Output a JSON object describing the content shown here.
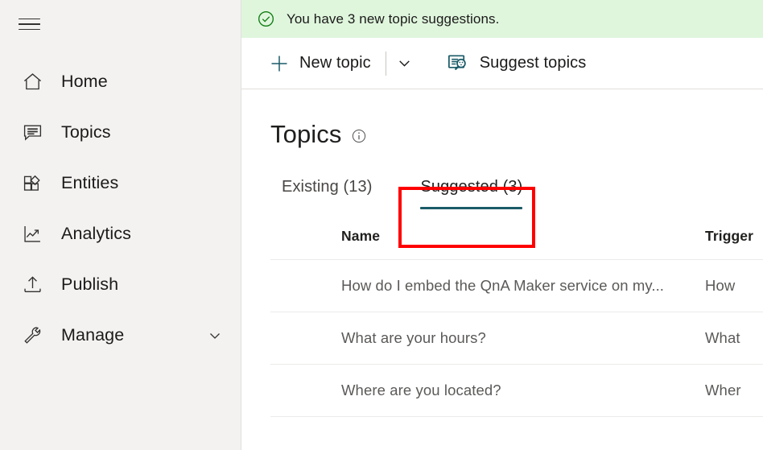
{
  "sidebar": {
    "menu_icon": "hamburger-icon",
    "items": [
      {
        "label": "Home",
        "icon": "home-icon",
        "has_chevron": false
      },
      {
        "label": "Topics",
        "icon": "chat-bubble-icon",
        "has_chevron": false
      },
      {
        "label": "Entities",
        "icon": "entities-grid-icon",
        "has_chevron": false
      },
      {
        "label": "Analytics",
        "icon": "line-chart-icon",
        "has_chevron": false
      },
      {
        "label": "Publish",
        "icon": "upload-arrow-icon",
        "has_chevron": false
      },
      {
        "label": "Manage",
        "icon": "wrench-icon",
        "has_chevron": true
      }
    ]
  },
  "notification": {
    "icon": "success-check-circle-icon",
    "message": "You have 3 new topic suggestions.",
    "background_color": "#dff6dd",
    "icon_color": "#107c10"
  },
  "commandbar": {
    "new_topic_label": "New topic",
    "new_topic_icon": "plus-icon",
    "caret_icon": "chevron-down-icon",
    "suggest_topics_label": "Suggest topics",
    "suggest_topics_icon": "suggest-topics-icon",
    "accent_color": "#1b5b68"
  },
  "page": {
    "title": "Topics",
    "info_icon": "info-circle-icon"
  },
  "tabs": [
    {
      "label": "Existing (13)",
      "active": false
    },
    {
      "label": "Suggested (3)",
      "active": true
    }
  ],
  "annotation": {
    "target": "Suggested (3)",
    "color": "#ff0000"
  },
  "table": {
    "columns": [
      "Name",
      "Trigger"
    ],
    "rows": [
      {
        "name": "How do I embed the QnA Maker service on my...",
        "trigger": "How"
      },
      {
        "name": "What are your hours?",
        "trigger": "What"
      },
      {
        "name": "Where are you located?",
        "trigger": "Wher"
      }
    ]
  }
}
